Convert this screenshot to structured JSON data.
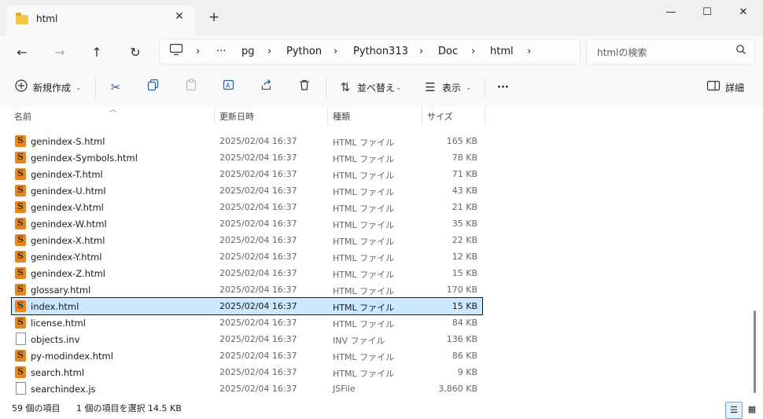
{
  "window": {
    "tab_title": "html",
    "tab_close": "✕",
    "new_tab": "+",
    "minimize": "—",
    "maximize": "☐",
    "close": "✕"
  },
  "nav": {
    "back": "←",
    "forward": "→",
    "up": "↑",
    "refresh": "↻",
    "breadcrumb": [
      "pg",
      "Python",
      "Python313",
      "Doc",
      "html"
    ],
    "more": "···",
    "chevron": "›",
    "search_placeholder": "htmlの検索"
  },
  "toolbar": {
    "new_label": "新規作成",
    "sort_label": "並べ替え",
    "view_label": "表示",
    "more_label": "···",
    "details_label": "詳細"
  },
  "columns": {
    "name": "名前",
    "date": "更新日時",
    "type": "種類",
    "size": "サイズ"
  },
  "files": [
    {
      "name": "genindex-S.html",
      "date": "2025/02/04 16:37",
      "type": "HTML ファイル",
      "size": "165 KB",
      "icon": "html"
    },
    {
      "name": "genindex-Symbols.html",
      "date": "2025/02/04 16:37",
      "type": "HTML ファイル",
      "size": "78 KB",
      "icon": "html"
    },
    {
      "name": "genindex-T.html",
      "date": "2025/02/04 16:37",
      "type": "HTML ファイル",
      "size": "71 KB",
      "icon": "html"
    },
    {
      "name": "genindex-U.html",
      "date": "2025/02/04 16:37",
      "type": "HTML ファイル",
      "size": "43 KB",
      "icon": "html"
    },
    {
      "name": "genindex-V.html",
      "date": "2025/02/04 16:37",
      "type": "HTML ファイル",
      "size": "21 KB",
      "icon": "html"
    },
    {
      "name": "genindex-W.html",
      "date": "2025/02/04 16:37",
      "type": "HTML ファイル",
      "size": "35 KB",
      "icon": "html"
    },
    {
      "name": "genindex-X.html",
      "date": "2025/02/04 16:37",
      "type": "HTML ファイル",
      "size": "22 KB",
      "icon": "html"
    },
    {
      "name": "genindex-Y.html",
      "date": "2025/02/04 16:37",
      "type": "HTML ファイル",
      "size": "12 KB",
      "icon": "html"
    },
    {
      "name": "genindex-Z.html",
      "date": "2025/02/04 16:37",
      "type": "HTML ファイル",
      "size": "15 KB",
      "icon": "html"
    },
    {
      "name": "glossary.html",
      "date": "2025/02/04 16:37",
      "type": "HTML ファイル",
      "size": "170 KB",
      "icon": "html"
    },
    {
      "name": "index.html",
      "date": "2025/02/04 16:37",
      "type": "HTML ファイル",
      "size": "15 KB",
      "icon": "html",
      "selected": true
    },
    {
      "name": "license.html",
      "date": "2025/02/04 16:37",
      "type": "HTML ファイル",
      "size": "84 KB",
      "icon": "html"
    },
    {
      "name": "objects.inv",
      "date": "2025/02/04 16:37",
      "type": "INV ファイル",
      "size": "136 KB",
      "icon": "plain"
    },
    {
      "name": "py-modindex.html",
      "date": "2025/02/04 16:37",
      "type": "HTML ファイル",
      "size": "86 KB",
      "icon": "html"
    },
    {
      "name": "search.html",
      "date": "2025/02/04 16:37",
      "type": "HTML ファイル",
      "size": "9 KB",
      "icon": "html"
    },
    {
      "name": "searchindex.js",
      "date": "2025/02/04 16:37",
      "type": "JSFile",
      "size": "3,860 KB",
      "icon": "plain"
    }
  ],
  "status": {
    "item_count": "59 個の項目",
    "selection": "1 個の項目を選択  14.5 KB"
  }
}
